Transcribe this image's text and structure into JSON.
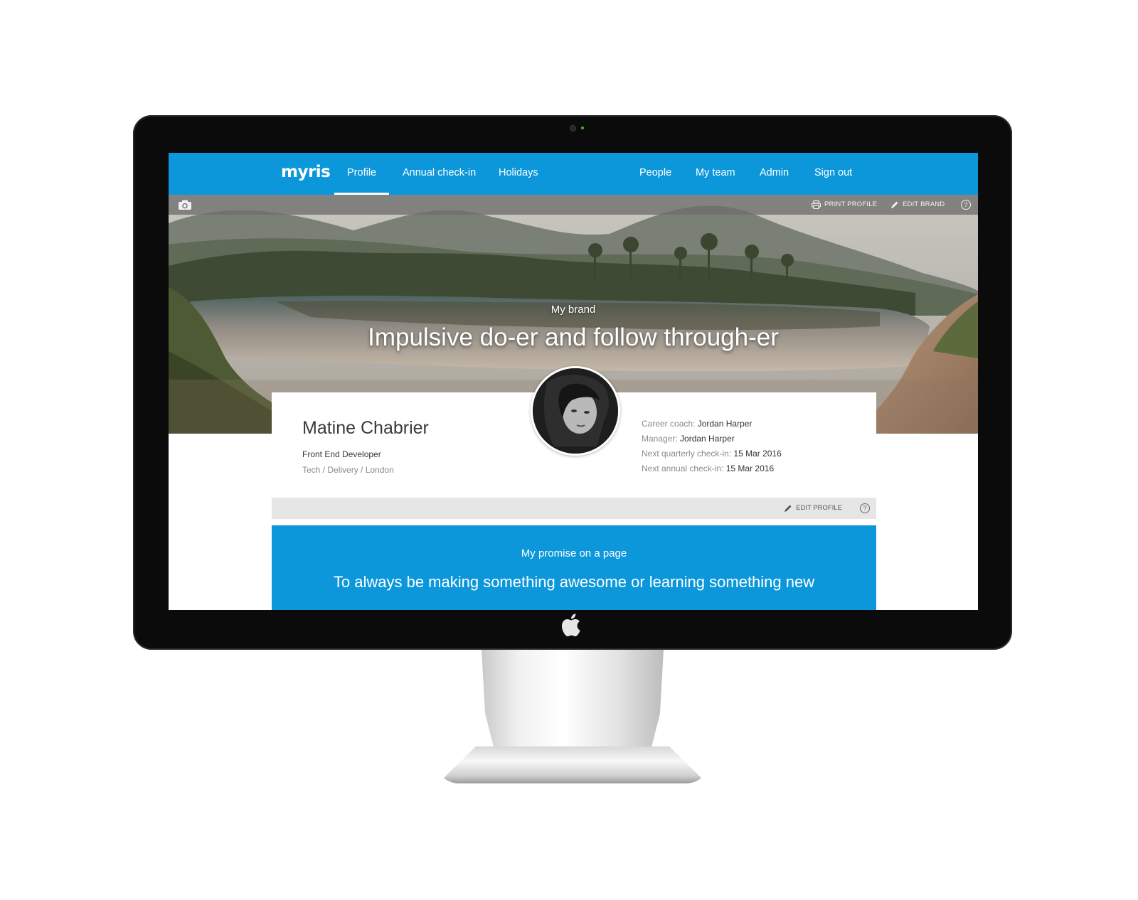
{
  "nav": {
    "logo": "myris",
    "left_links": [
      "Profile",
      "Annual check-in",
      "Holidays"
    ],
    "right_links": [
      "People",
      "My team",
      "Admin",
      "Sign out"
    ],
    "active": "Profile"
  },
  "toolbar": {
    "print_label": "PRINT PROFILE",
    "edit_brand_label": "EDIT BRAND",
    "help_glyph": "?"
  },
  "brand": {
    "label": "My brand",
    "statement": "Impulsive do-er and follow through-er"
  },
  "profile": {
    "name": "Matine Chabrier",
    "role": "Front End Developer",
    "department": "Tech / Delivery / London",
    "meta": [
      {
        "key": "Career coach: ",
        "value": "Jordan Harper"
      },
      {
        "key": "Manager: ",
        "value": "Jordan Harper"
      },
      {
        "key": "Next quarterly check-in: ",
        "value": "15 Mar 2016"
      },
      {
        "key": "Next annual check-in: ",
        "value": "15 Mar 2016"
      }
    ],
    "edit_label": "EDIT PROFILE",
    "help_glyph": "?"
  },
  "promise": {
    "label": "My promise on a page",
    "text": "To always be making something awesome or learning something new"
  },
  "colors": {
    "brand_blue": "#0d97db",
    "bezel": "#0b0b0b",
    "footer_grey": "#e6e6e6"
  },
  "icons": [
    "camera-icon",
    "printer-icon",
    "pencil-icon",
    "help-icon",
    "apple-logo-icon"
  ]
}
